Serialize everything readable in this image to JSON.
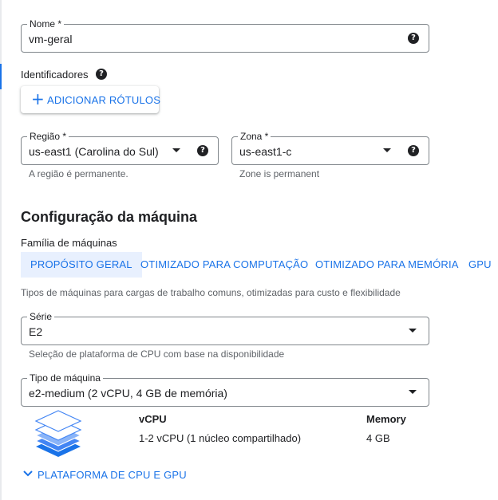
{
  "name_field": {
    "label": "Nome *",
    "value": "vm-geral"
  },
  "identifiers": {
    "label": "Identificadores",
    "add_labels_button": "ADICIONAR RÓTULOS"
  },
  "region_field": {
    "label": "Região *",
    "value": "us-east1 (Carolina do Sul)",
    "hint": "A região é permanente."
  },
  "zone_field": {
    "label": "Zona *",
    "value": "us-east1-c",
    "hint": "Zone is permanent"
  },
  "machine_config": {
    "heading": "Configuração da máquina",
    "family_label": "Família de máquinas",
    "tabs": [
      {
        "label": "PROPÓSITO GERAL",
        "active": true
      },
      {
        "label": "OTIMIZADO PARA COMPUTAÇÃO",
        "active": false
      },
      {
        "label": "OTIMIZADO PARA MEMÓRIA",
        "active": false
      },
      {
        "label": "GPU",
        "active": false
      }
    ],
    "tab_description": "Tipos de máquinas para cargas de trabalho comuns, otimizadas para custo e flexibilidade",
    "series_field": {
      "label": "Série",
      "value": "E2",
      "hint": "Seleção de plataforma de CPU com base na disponibilidade"
    },
    "machine_type_field": {
      "label": "Tipo de máquina",
      "value": "e2-medium (2 vCPU, 4 GB de memória)"
    },
    "specs": {
      "vcpu_header": "vCPU",
      "memory_header": "Memory",
      "vcpu_value": "1-2 vCPU (1 núcleo compartilhado)",
      "memory_value": "4 GB"
    },
    "expand_link": "PLATAFORMA DE CPU E GPU"
  },
  "colors": {
    "accent": "#1a73e8",
    "accent_bg": "#e8f0fe",
    "border": "#80868b",
    "hint_text": "#5f6368"
  },
  "icons": {
    "help": "help-icon",
    "dropdown": "caret-down-icon",
    "add": "plus-icon",
    "expand": "chevron-down-icon",
    "machine": "stacked-layers-icon"
  }
}
